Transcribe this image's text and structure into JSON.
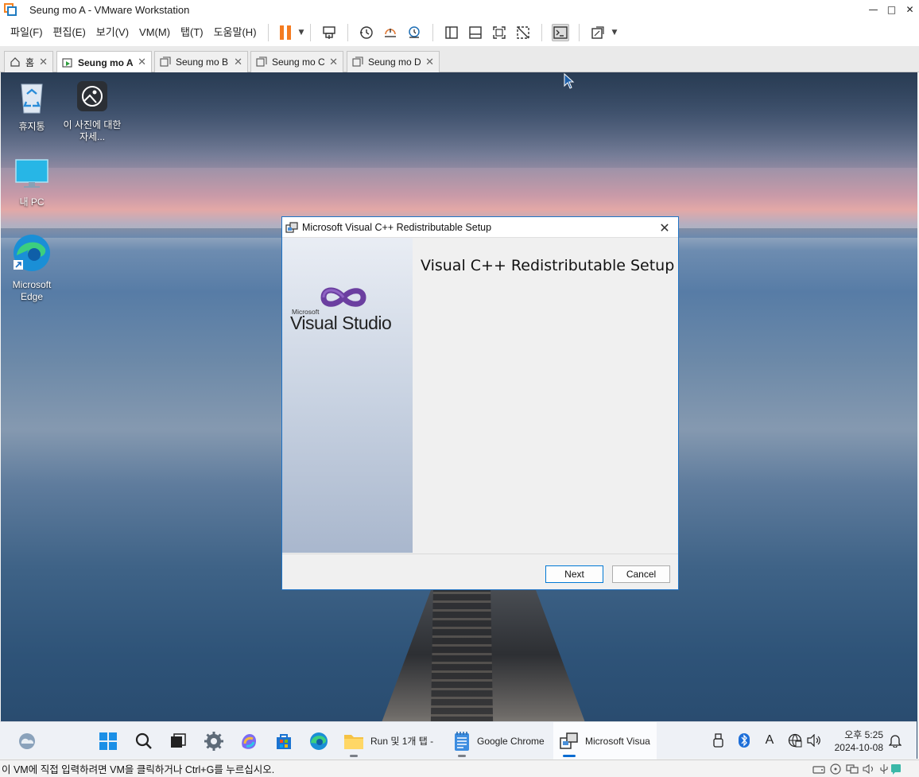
{
  "window": {
    "title": "Seung mo A - VMware Workstation"
  },
  "menu": [
    "파일(F)",
    "편집(E)",
    "보기(V)",
    "VM(M)",
    "탭(T)",
    "도움말(H)"
  ],
  "tabs": [
    {
      "label": "홈",
      "icon": "home-icon",
      "active": false
    },
    {
      "label": "Seung mo A",
      "icon": "vm-running-icon",
      "active": true
    },
    {
      "label": "Seung mo B",
      "icon": "vm-icon",
      "active": false
    },
    {
      "label": "Seung mo C",
      "icon": "vm-icon",
      "active": false
    },
    {
      "label": "Seung mo D",
      "icon": "vm-icon",
      "active": false
    }
  ],
  "desktop": {
    "icons": [
      {
        "label": "휴지통",
        "icon": "recycle-bin-icon"
      },
      {
        "label": "이 사진에 대한 자세...",
        "icon": "picture-info-icon"
      },
      {
        "label": "내 PC",
        "icon": "this-pc-icon"
      },
      {
        "label": "Microsoft Edge",
        "icon": "edge-icon"
      }
    ]
  },
  "dialog": {
    "title": "Microsoft Visual C++ Redistributable Setup",
    "heading": "Visual C++ Redistributable Setup",
    "logo_small": "Microsoft",
    "logo_text": "Visual Studio",
    "next_label": "Next",
    "cancel_label": "Cancel"
  },
  "taskbar": {
    "apps": [
      {
        "label": "Run 및 1개 탭 -",
        "icon": "folder-icon"
      },
      {
        "label": "Google Chrome",
        "icon": "notepad-icon"
      },
      {
        "label": "Microsoft Visua",
        "icon": "installer-icon"
      }
    ],
    "clock_time": "오후 5:25",
    "clock_date": "2024-10-08",
    "lang": "A"
  },
  "status": {
    "text": "이 VM에 직접 입력하려면 VM을 클릭하거나 Ctrl+G를 누르십시오."
  },
  "colors": {
    "accent": "#0078d4",
    "pause": "#f47b20",
    "dialog_border": "#1f73c5"
  }
}
